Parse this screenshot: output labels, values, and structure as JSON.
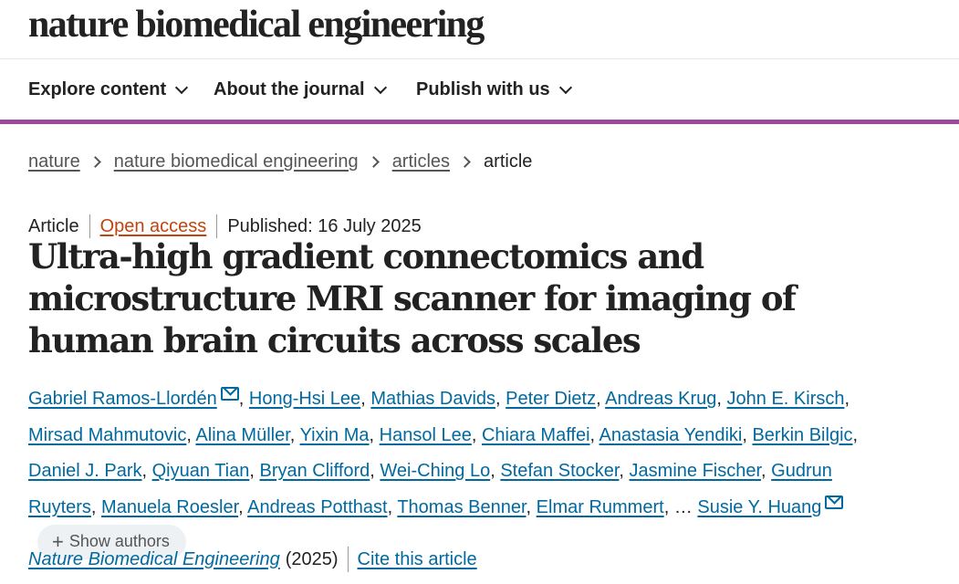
{
  "site": {
    "logo": "nature biomedical engineering"
  },
  "nav": [
    {
      "label": "Explore content"
    },
    {
      "label": "About the journal"
    },
    {
      "label": "Publish with us"
    }
  ],
  "breadcrumb": {
    "links": [
      "nature",
      "nature biomedical engineering",
      "articles"
    ],
    "current": "article"
  },
  "article": {
    "type": "Article",
    "access": "Open access",
    "published": "Published: 16 July 2025",
    "title": "Ultra-high gradient connectomics and microstructure MRI scanner for imaging of human brain circuits across scales",
    "authors": [
      "Gabriel Ramos-Llordén",
      "Hong-Hsi Lee",
      "Mathias Davids",
      "Peter Dietz",
      "Andreas Krug",
      "John E. Kirsch",
      "Mirsad Mahmutovic",
      "Alina Müller",
      "Yixin Ma",
      "Hansol Lee",
      "Chiara Maffei",
      "Anastasia Yendiki",
      "Berkin Bilgic",
      "Daniel J. Park",
      "Qiyuan Tian",
      "Bryan Clifford",
      "Wei-Ching Lo",
      "Stefan Stocker",
      "Jasmine Fischer",
      "Gudrun Ruyters",
      "Manuela Roesler",
      "Andreas Potthast",
      "Thomas Benner",
      "Elmar Rummert",
      "Susie Y. Huang"
    ],
    "ellipsis": "…",
    "show_authors_label": "Show authors",
    "journal": "Nature Biomedical Engineering",
    "year": "(2025)",
    "cite_label": "Cite this article"
  }
}
